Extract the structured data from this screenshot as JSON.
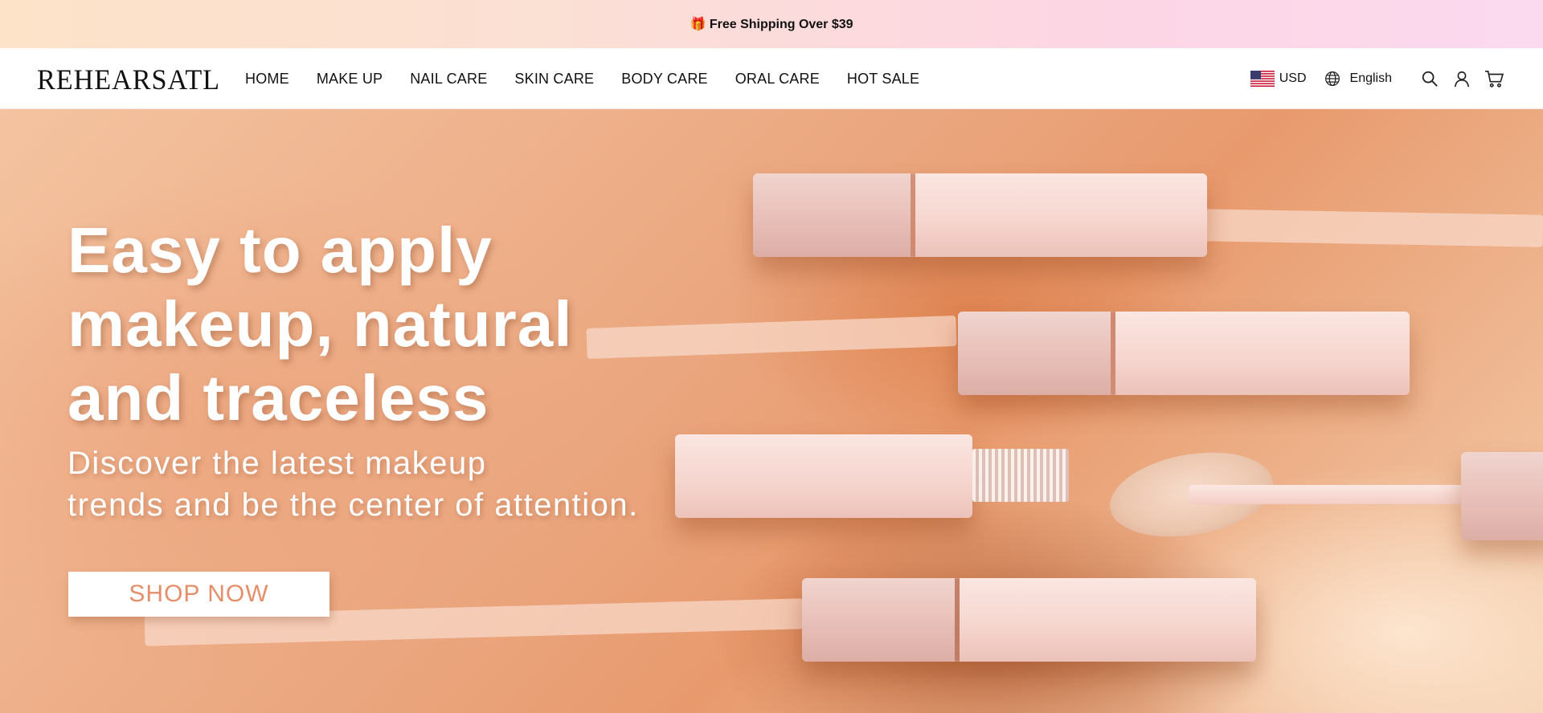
{
  "announcement": {
    "icon": "gift-icon",
    "text": "Free Shipping Over $39",
    "full_text": "🎁 Free Shipping Over $39"
  },
  "header": {
    "logo": "REHEARSATL",
    "nav": [
      {
        "label": "HOME"
      },
      {
        "label": "MAKE UP"
      },
      {
        "label": "NAIL CARE"
      },
      {
        "label": "SKIN CARE"
      },
      {
        "label": "BODY CARE"
      },
      {
        "label": "ORAL CARE"
      },
      {
        "label": "HOT SALE"
      }
    ],
    "currency": {
      "flag": "us-flag-icon",
      "label": "USD"
    },
    "language": {
      "icon": "globe-icon",
      "label": "English"
    },
    "icons": [
      "search-icon",
      "account-icon",
      "cart-icon"
    ]
  },
  "hero": {
    "headline": "Easy to apply makeup, natural and traceless",
    "headline_lines": [
      "Easy to apply",
      "makeup, natural",
      "and traceless"
    ],
    "subheading_lines": [
      "Discover the latest makeup",
      "trends and be the center of attention."
    ],
    "cta_label": "SHOP NOW",
    "colors": {
      "cta_text": "#e48e6a",
      "background": "#eaa57d"
    }
  }
}
